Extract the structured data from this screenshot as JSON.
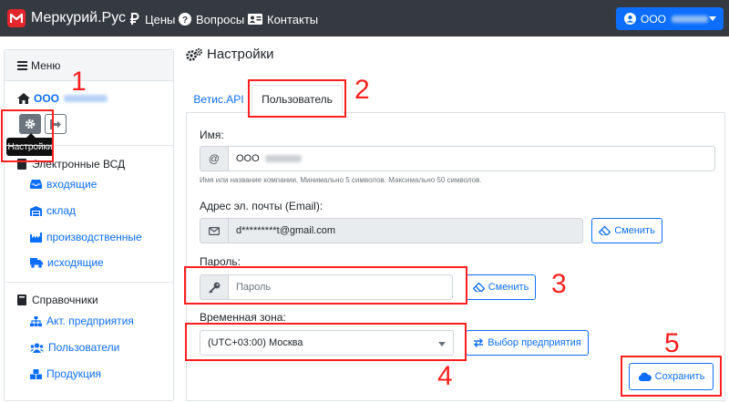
{
  "navbar": {
    "brand": "Меркурий.Рус",
    "links": [
      {
        "label": "Цены",
        "icon": "ruble-icon"
      },
      {
        "label": "Вопросы",
        "icon": "question-circle-icon"
      },
      {
        "label": "Контакты",
        "icon": "address-card-icon"
      }
    ],
    "account_label": "ООО"
  },
  "sidebar": {
    "menu_label": "Меню",
    "org_label": "ООО",
    "tooltip": "Настройки",
    "sections": [
      {
        "title": "Электронные ВСД",
        "items": [
          {
            "label": "входящие"
          },
          {
            "label": "склад"
          },
          {
            "label": "производственные"
          },
          {
            "label": "исходящие"
          }
        ]
      },
      {
        "title": "Справочники",
        "items": [
          {
            "label": "Акт. предприятия"
          },
          {
            "label": "Пользователи"
          },
          {
            "label": "Продукция"
          }
        ]
      }
    ]
  },
  "main": {
    "title": "Настройки",
    "tabs": [
      {
        "label": "Ветис.API",
        "active": false
      },
      {
        "label": "Пользователь",
        "active": true
      }
    ],
    "form": {
      "name_label": "Имя:",
      "name_addon": "@",
      "name_value": "ООО",
      "name_help": "Имя или название компании. Минимально 5 символов. Максимально 50 символов.",
      "email_label": "Адрес эл. почты (Email):",
      "email_value": "d*********t@gmail.com",
      "email_change": "Сменить",
      "password_label": "Пароль:",
      "password_placeholder": "Пароль",
      "password_change": "Сменить",
      "timezone_label": "Временная зона:",
      "timezone_value": "(UTC+03:00) Москва",
      "pick_enterprise": "Выбор предприятия",
      "save": "Сохранить"
    }
  },
  "annotations": [
    "1",
    "2",
    "3",
    "4",
    "5"
  ],
  "colors": {
    "navbar": "#343a40",
    "primary": "#0d6efd",
    "annotation": "#ff1f1f",
    "logo": "#e5262d"
  }
}
